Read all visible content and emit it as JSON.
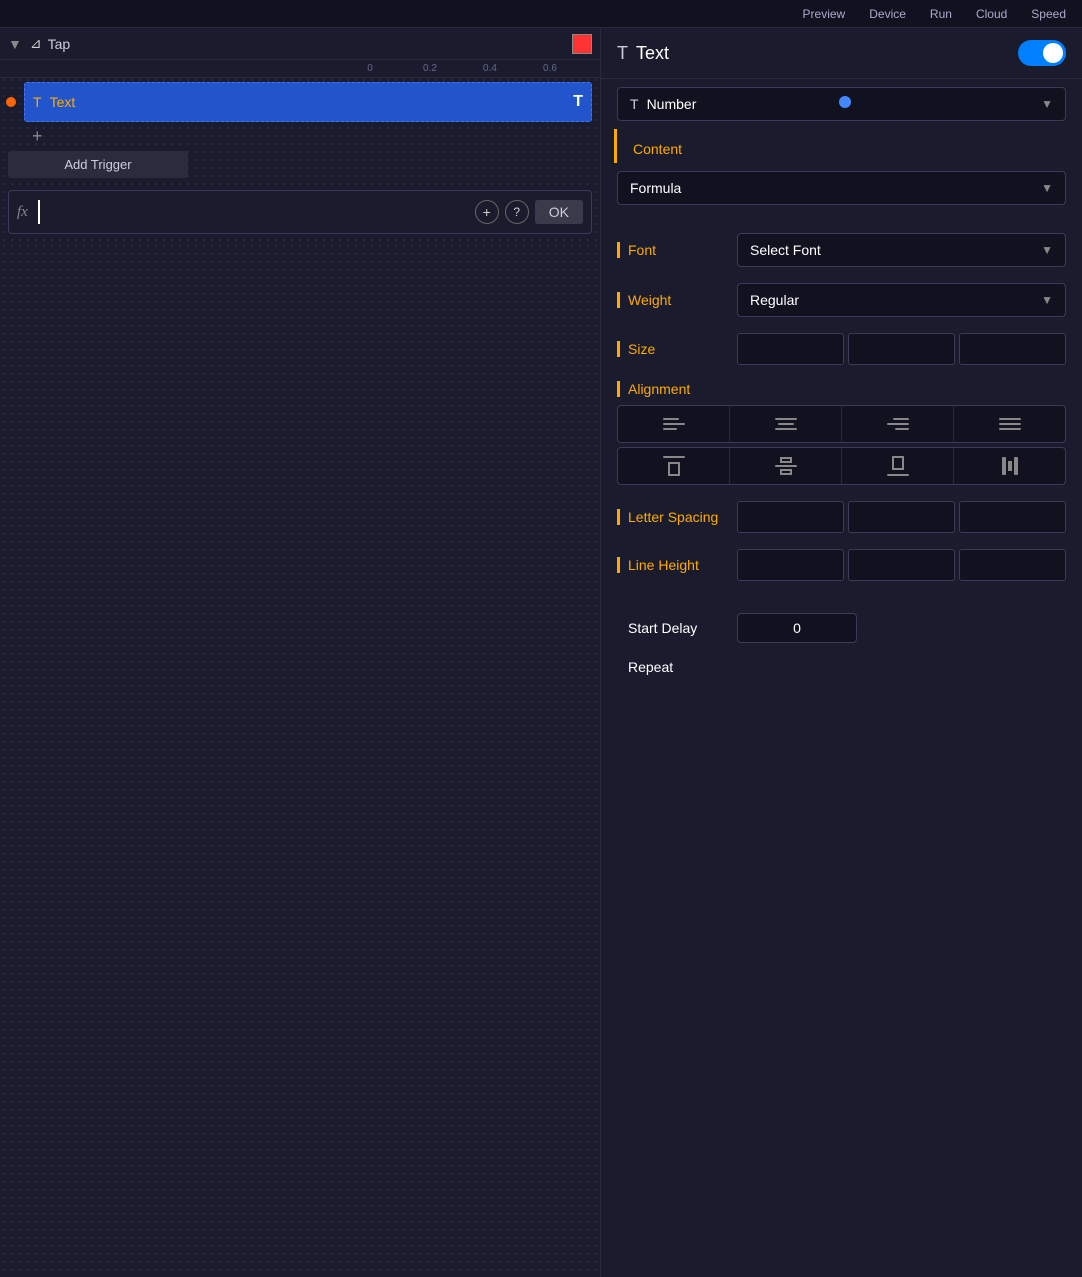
{
  "topNav": {
    "items": [
      "Preview",
      "Device",
      "Run",
      "Cloud",
      "Speed"
    ]
  },
  "timeline": {
    "chevron": "▼",
    "tapIcon": "⊿",
    "tapLabel": "Tap",
    "colorSquare": "#ff3333",
    "ruler": {
      "ticks": [
        "0",
        "0.2",
        "0.4",
        "0.6"
      ]
    },
    "track": {
      "icon": "T",
      "name": "Text",
      "rightIcon": "T"
    },
    "addTrigger": "Add Trigger",
    "plus": "+"
  },
  "formula": {
    "fxLabel": "fx",
    "addLabel": "+",
    "helpLabel": "?",
    "okLabel": "OK"
  },
  "rightPanel": {
    "title": "Text",
    "typeDropdown": {
      "icon": "T",
      "label": "Number"
    },
    "content": {
      "sectionLabel": "Content",
      "formulaDropdown": "Formula"
    },
    "font": {
      "label": "Font",
      "dropdown": "Select Font"
    },
    "weight": {
      "label": "Weight",
      "dropdown": "Regular"
    },
    "size": {
      "label": "Size"
    },
    "alignment": {
      "label": "Alignment"
    },
    "letterSpacing": {
      "label": "Letter Spacing"
    },
    "lineHeight": {
      "label": "Line Height"
    },
    "startDelay": {
      "label": "Start Delay",
      "value": "0"
    },
    "repeat": {
      "label": "Repeat"
    }
  }
}
